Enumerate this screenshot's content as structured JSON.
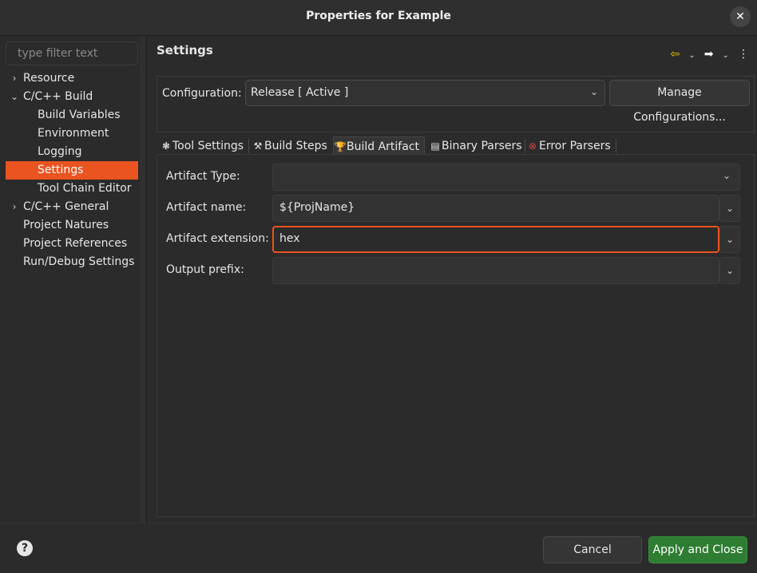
{
  "window": {
    "title": "Properties for Example",
    "close_symbol": "✕"
  },
  "filter": {
    "placeholder": "type filter text"
  },
  "tree": [
    {
      "label": "Resource",
      "chev": "›",
      "indent": 0,
      "selected": false
    },
    {
      "label": "C/C++ Build",
      "chev": "⌄",
      "indent": 0,
      "selected": false
    },
    {
      "label": "Build Variables",
      "chev": "",
      "indent": 1,
      "selected": false
    },
    {
      "label": "Environment",
      "chev": "",
      "indent": 1,
      "selected": false
    },
    {
      "label": "Logging",
      "chev": "",
      "indent": 1,
      "selected": false
    },
    {
      "label": "Settings",
      "chev": "",
      "indent": 1,
      "selected": true
    },
    {
      "label": "Tool Chain Editor",
      "chev": "",
      "indent": 1,
      "selected": false
    },
    {
      "label": "C/C++ General",
      "chev": "›",
      "indent": 0,
      "selected": false
    },
    {
      "label": "Project Natures",
      "chev": "",
      "indent": 0,
      "selected": false
    },
    {
      "label": "Project References",
      "chev": "",
      "indent": 0,
      "selected": false
    },
    {
      "label": "Run/Debug Settings",
      "chev": "",
      "indent": 0,
      "selected": false
    }
  ],
  "page": {
    "title": "Settings"
  },
  "nav": {
    "back": "⇦",
    "forward": "➡",
    "chevron": "⌄",
    "menu": "⋮"
  },
  "configuration": {
    "label": "Configuration:",
    "value": "Release  [ Active ]",
    "manage_label": "Manage Configurations..."
  },
  "tabs": [
    {
      "label": "Tool Settings",
      "icon": "❃",
      "icon_name": "tool-settings-icon",
      "active": false
    },
    {
      "label": "Build Steps",
      "icon": "⚒",
      "icon_name": "build-steps-icon",
      "active": false
    },
    {
      "label": "Build Artifact",
      "icon": "🏆",
      "icon_name": "trophy-icon",
      "active": true
    },
    {
      "label": "Binary Parsers",
      "icon": "▤",
      "icon_name": "binary-parsers-icon",
      "active": false
    },
    {
      "label": "Error Parsers",
      "icon": "⊗",
      "icon_name": "error-parsers-icon",
      "active": false
    }
  ],
  "fields": {
    "artifact_type": {
      "label": "Artifact Type:",
      "value": ""
    },
    "artifact_name": {
      "label": "Artifact name:",
      "value": "${ProjName}"
    },
    "artifact_extension": {
      "label": "Artifact extension:",
      "value": "hex"
    },
    "output_prefix": {
      "label": "Output prefix:",
      "value": ""
    }
  },
  "footer": {
    "help": "?",
    "cancel_label": "Cancel",
    "apply_label": "Apply and Close"
  },
  "colors": {
    "accent": "#e95420",
    "apply": "#2e7d32",
    "background": "#2b2b2b"
  }
}
